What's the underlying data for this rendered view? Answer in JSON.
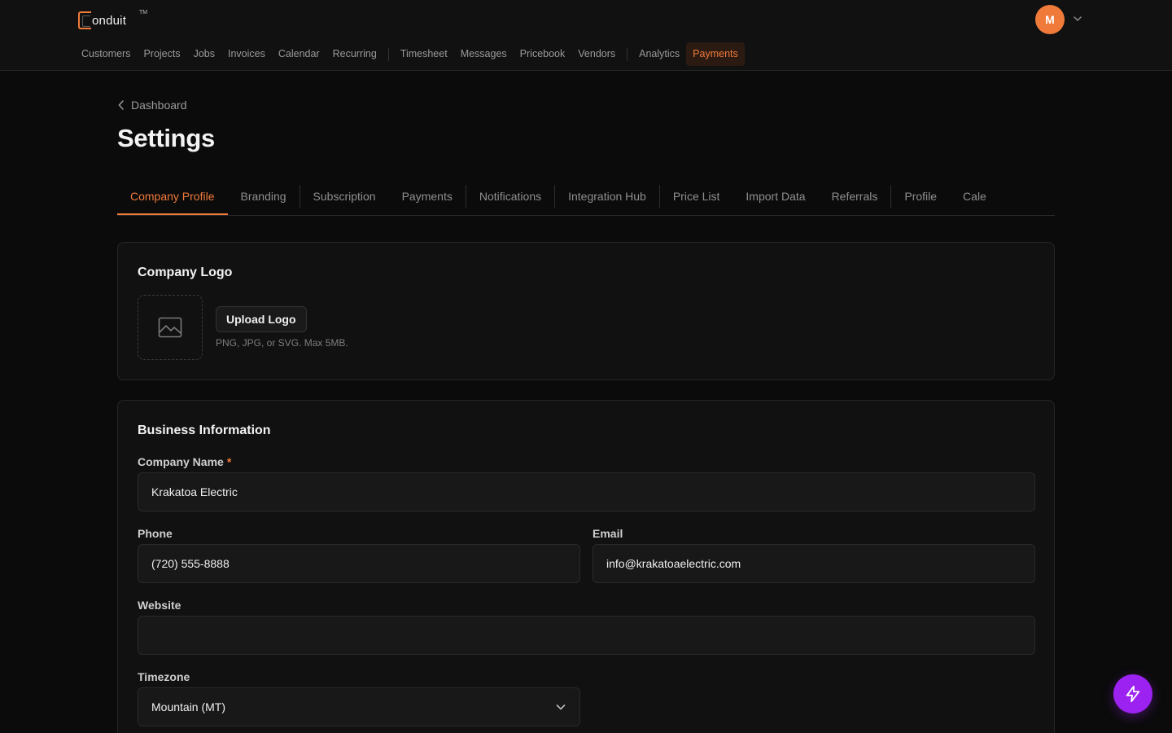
{
  "brand": {
    "name": "onduit",
    "tm": "TM",
    "accent": "#f07a3a"
  },
  "user": {
    "initial": "M"
  },
  "nav": {
    "groups": [
      [
        "Customers",
        "Projects",
        "Jobs",
        "Invoices",
        "Calendar",
        "Recurring"
      ],
      [
        "Timesheet",
        "Messages",
        "Pricebook",
        "Vendors"
      ],
      [
        "Analytics",
        "Payments"
      ]
    ],
    "active": "Payments"
  },
  "breadcrumb": {
    "label": "Dashboard"
  },
  "page": {
    "title": "Settings"
  },
  "tabs": {
    "items": [
      "Company Profile",
      "Branding",
      "Subscription",
      "Payments",
      "Notifications",
      "Integration Hub",
      "Price List",
      "Import Data",
      "Referrals",
      "Profile",
      "Cale"
    ],
    "active": "Company Profile"
  },
  "logo_card": {
    "title": "Company Logo",
    "upload_label": "Upload Logo",
    "hint": "PNG, JPG, or SVG. Max 5MB."
  },
  "business": {
    "title": "Business Information",
    "company_name_label": "Company Name",
    "required_mark": "*",
    "company_name_value": "Krakatoa Electric",
    "phone_label": "Phone",
    "phone_value": "(720) 555-8888",
    "email_label": "Email",
    "email_value": "info@krakatoaelectric.com",
    "website_label": "Website",
    "website_value": "",
    "timezone_label": "Timezone",
    "timezone_value": "Mountain (MT)"
  },
  "colors": {
    "accent": "#f07a3a",
    "fab": "#9b22f0",
    "background": "#0b0b0b"
  }
}
